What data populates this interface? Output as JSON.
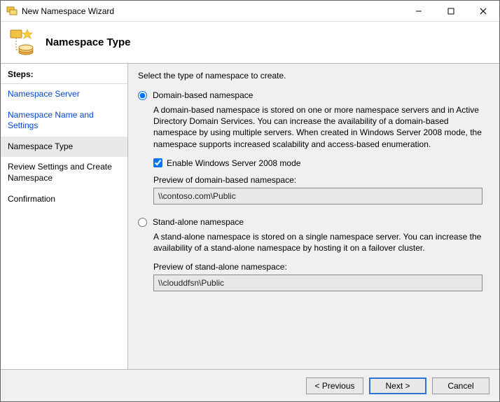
{
  "window": {
    "title": "New Namespace Wizard"
  },
  "header": {
    "title": "Namespace Type"
  },
  "sidebar": {
    "header": "Steps:",
    "items": [
      {
        "label": "Namespace Server",
        "state": "done"
      },
      {
        "label": "Namespace Name and Settings",
        "state": "done"
      },
      {
        "label": "Namespace Type",
        "state": "current"
      },
      {
        "label": "Review Settings and Create Namespace",
        "state": "upcoming"
      },
      {
        "label": "Confirmation",
        "state": "upcoming"
      }
    ]
  },
  "main": {
    "instruction": "Select the type of namespace to create.",
    "option1": {
      "label": "Domain-based namespace",
      "selected": true,
      "desc": "A domain-based namespace is stored on one or more namespace servers and in Active Directory Domain Services. You can increase the availability of a domain-based namespace by using multiple servers. When created in Windows Server 2008 mode, the namespace supports increased scalability and access-based enumeration.",
      "checkbox_label": "Enable Windows Server 2008 mode",
      "checkbox_checked": true,
      "preview_label": "Preview of domain-based namespace:",
      "preview_value": "\\\\contoso.com\\Public"
    },
    "option2": {
      "label": "Stand-alone namespace",
      "selected": false,
      "desc": "A stand-alone namespace is stored on a single namespace server. You can increase the availability of a stand-alone namespace by hosting it on a failover cluster.",
      "preview_label": "Preview of stand-alone namespace:",
      "preview_value": "\\\\clouddfsn\\Public"
    }
  },
  "footer": {
    "previous": "< Previous",
    "next": "Next >",
    "cancel": "Cancel"
  }
}
